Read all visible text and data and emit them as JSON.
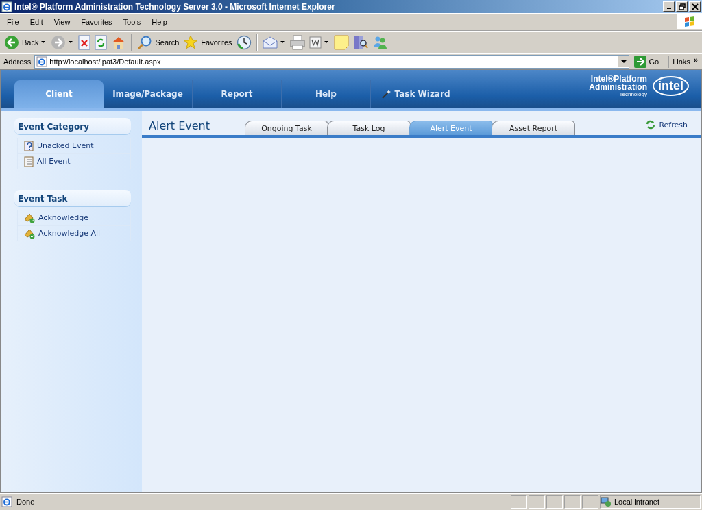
{
  "window": {
    "title": "Intel® Platform Administration Technology Server 3.0 - Microsoft Internet Explorer"
  },
  "menu_bar": [
    "File",
    "Edit",
    "View",
    "Favorites",
    "Tools",
    "Help"
  ],
  "toolbar": [
    {
      "kind": "back",
      "label": "Back"
    },
    {
      "kind": "forward"
    },
    {
      "kind": "stop"
    },
    {
      "kind": "refresh"
    },
    {
      "kind": "home"
    },
    {
      "kind": "search",
      "label": "Search"
    },
    {
      "kind": "favorites",
      "label": "Favorites"
    },
    {
      "kind": "history"
    },
    {
      "kind": "mail"
    },
    {
      "kind": "print"
    },
    {
      "kind": "edit"
    },
    {
      "kind": "note"
    },
    {
      "kind": "research"
    },
    {
      "kind": "messenger"
    }
  ],
  "address_bar": {
    "label": "Address",
    "value": "http://localhost/ipat3/Default.aspx",
    "go": "Go",
    "links": "Links",
    "more": "»"
  },
  "nav": [
    {
      "label": "Client",
      "selected": true
    },
    {
      "label": "Image/Package",
      "selected": false
    },
    {
      "label": "Report",
      "selected": false
    },
    {
      "label": "Help",
      "selected": false
    },
    {
      "label": "Task Wizard",
      "selected": false
    }
  ],
  "brand": {
    "line_1": "Intel®Platform",
    "line_2": "Administration",
    "line_3": "Technology",
    "logo": "intel"
  },
  "sidebar": [
    {
      "title": "Event Category",
      "items": [
        {
          "label": "Unacked Event",
          "kind": "question"
        },
        {
          "label": "All Event",
          "kind": "list"
        }
      ]
    },
    {
      "title": "Event Task",
      "items": [
        {
          "label": "Acknowledge",
          "kind": "bell"
        },
        {
          "label": "Acknowledge All",
          "kind": "bell"
        }
      ]
    }
  ],
  "content": {
    "title": "Alert Event",
    "tabs": [
      {
        "label": "Ongoing Task",
        "selected": false
      },
      {
        "label": "Task Log",
        "selected": false
      },
      {
        "label": "Alert Event",
        "selected": true
      },
      {
        "label": "Asset Report",
        "selected": false
      }
    ],
    "refresh": "Refresh"
  },
  "status_bar": {
    "text": "Done",
    "zone": "Local intranet"
  }
}
